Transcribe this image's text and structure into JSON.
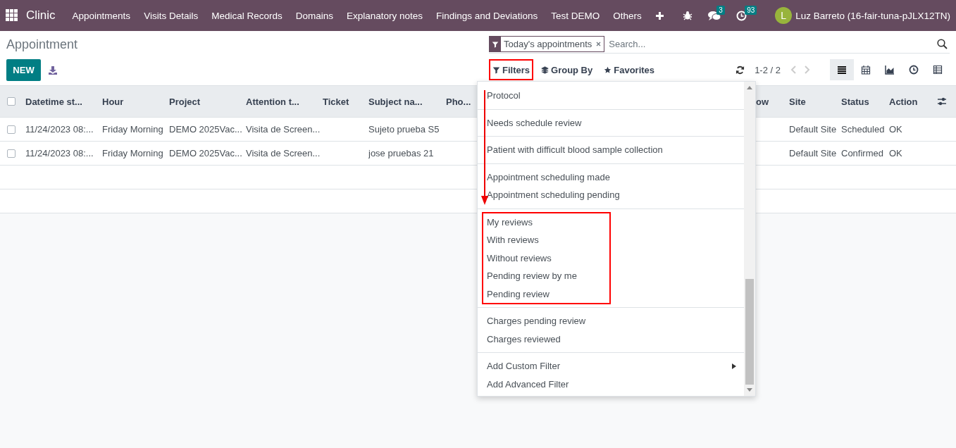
{
  "navbar": {
    "app_name": "Clinic",
    "menu": [
      "Appointments",
      "Visits Details",
      "Medical Records",
      "Domains",
      "Explanatory notes",
      "Findings and Deviations",
      "Test DEMO",
      "Others"
    ],
    "chat_badge": "3",
    "activity_badge": "93",
    "avatar_letter": "L",
    "user": "Luz Barreto (16-fair-tuna-pJLX12TN)"
  },
  "breadcrumb": "Appointment",
  "new_button": "NEW",
  "search": {
    "facet": "Today's appointments",
    "placeholder": "Search..."
  },
  "search_buttons": [
    {
      "kind": "filter",
      "label": "Filters",
      "highlighted": true
    },
    {
      "kind": "layers",
      "label": "Group By",
      "highlighted": false
    },
    {
      "kind": "star",
      "label": "Favorites",
      "highlighted": false
    }
  ],
  "pager": "1-2 / 2",
  "views": [
    {
      "kind": "list",
      "selected": true
    },
    {
      "kind": "calendar",
      "selected": false
    },
    {
      "kind": "graph",
      "selected": false
    },
    {
      "kind": "activity",
      "selected": false
    },
    {
      "kind": "pivot",
      "selected": false
    }
  ],
  "table": {
    "select_all_checked": false,
    "columns": [
      "Datetime st...",
      "Hour",
      "Project",
      "Attention t...",
      "Ticket",
      "Subject na...",
      "Pho...",
      "ow",
      "Site",
      "Status",
      "Action"
    ],
    "rows": [
      {
        "checked": false,
        "cells": [
          "11/24/2023 08:...",
          "Friday Morning",
          "DEMO 2025Vac...",
          "Visita de Screen...",
          null,
          "Sujeto prueba S5",
          null,
          null,
          "Default Site",
          "Scheduled",
          "OK"
        ]
      },
      {
        "checked": false,
        "cells": [
          "11/24/2023 08:...",
          "Friday Morning",
          "DEMO 2025Vac...",
          "Visita de Screen...",
          null,
          "jose pruebas 21",
          null,
          null,
          "Default Site",
          "Confirmed",
          "OK"
        ]
      }
    ]
  },
  "filters_menu": {
    "groups": [
      {
        "highlighted": false,
        "items": [
          {
            "label": "Protocol",
            "submenu": false
          }
        ]
      },
      {
        "highlighted": false,
        "items": [
          {
            "label": "Needs schedule review",
            "submenu": false
          }
        ]
      },
      {
        "highlighted": false,
        "items": [
          {
            "label": "Patient with difficult blood sample collection",
            "submenu": false
          }
        ]
      },
      {
        "highlighted": false,
        "items": [
          {
            "label": "Appointment scheduling made",
            "submenu": false
          },
          {
            "label": "Appointment scheduling pending",
            "submenu": false
          }
        ]
      },
      {
        "highlighted": true,
        "items": [
          {
            "label": "My reviews",
            "submenu": false
          },
          {
            "label": "With reviews",
            "submenu": false
          },
          {
            "label": "Without reviews",
            "submenu": false
          },
          {
            "label": "Pending review by me",
            "submenu": false
          },
          {
            "label": "Pending review",
            "submenu": false
          }
        ]
      },
      {
        "highlighted": false,
        "items": [
          {
            "label": "Charges pending review",
            "submenu": false
          },
          {
            "label": "Charges reviewed",
            "submenu": false
          }
        ]
      },
      {
        "highlighted": false,
        "items": [
          {
            "label": "Add Custom Filter",
            "submenu": true
          },
          {
            "label": "Add Advanced Filter",
            "submenu": false
          }
        ]
      }
    ]
  }
}
